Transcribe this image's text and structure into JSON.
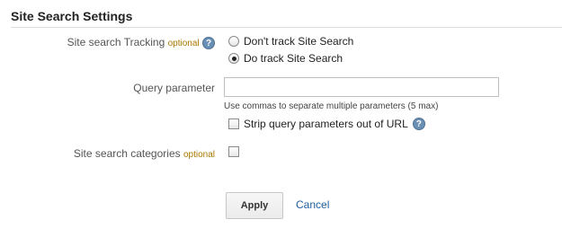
{
  "section": {
    "title": "Site Search Settings"
  },
  "tracking": {
    "label": "Site search Tracking",
    "optional": "optional",
    "help": "?",
    "options": [
      {
        "label": "Don't track Site Search",
        "checked": false
      },
      {
        "label": "Do track Site Search",
        "checked": true
      }
    ]
  },
  "query": {
    "label": "Query parameter",
    "value": "",
    "hint": "Use commas to separate multiple parameters (5 max)",
    "strip_label": "Strip query parameters out of URL",
    "strip_checked": false,
    "help": "?"
  },
  "categories": {
    "label": "Site search categories",
    "optional": "optional",
    "checked": false
  },
  "actions": {
    "apply": "Apply",
    "cancel": "Cancel"
  }
}
